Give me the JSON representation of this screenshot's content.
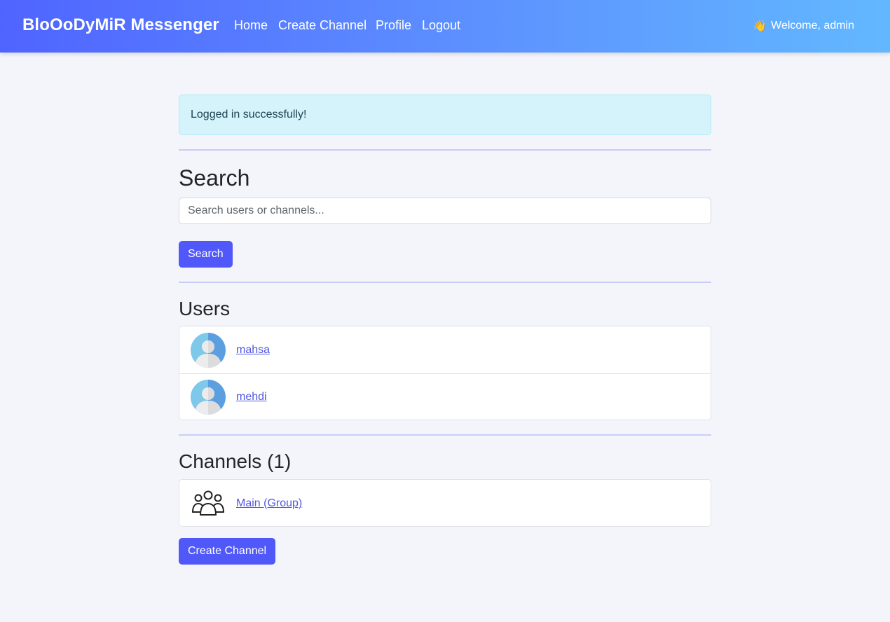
{
  "navbar": {
    "brand": "BloOoDyMiR Messenger",
    "links": [
      "Home",
      "Create Channel",
      "Profile",
      "Logout"
    ],
    "wave_icon": "👋",
    "welcome": "Welcome, admin"
  },
  "alert": {
    "message": "Logged in successfully!"
  },
  "search": {
    "heading": "Search",
    "placeholder": "Search users or channels...",
    "button": "Search"
  },
  "users": {
    "heading": "Users",
    "items": [
      {
        "name": "mahsa",
        "icon": "user-avatar-icon"
      },
      {
        "name": "mehdi",
        "icon": "user-avatar-icon"
      }
    ]
  },
  "channels": {
    "heading": "Channels (1)",
    "items": [
      {
        "name": "Main (Group)",
        "icon": "group-icon"
      }
    ],
    "create_button": "Create Channel"
  },
  "colors": {
    "nav_gradient_start": "#4f64ff",
    "nav_gradient_end": "#62b8ff",
    "primary_button": "#5058fa",
    "alert_bg": "#d5f3fb",
    "link": "#5058e0"
  }
}
